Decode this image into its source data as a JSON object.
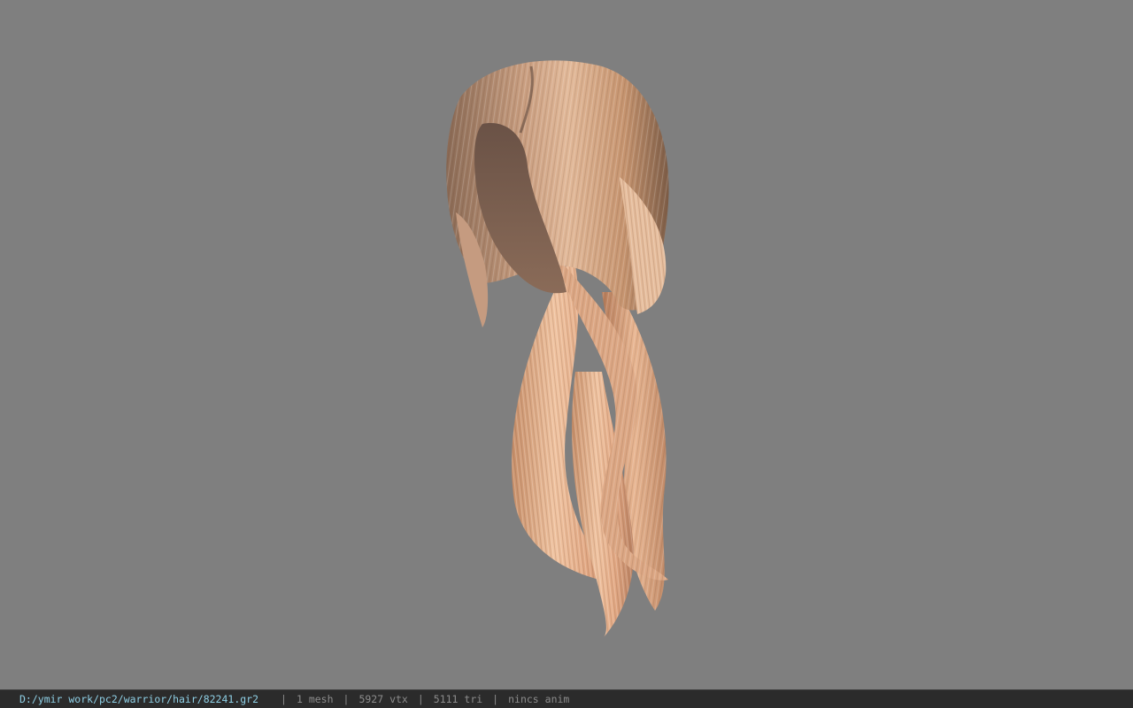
{
  "viewport": {
    "background": "#7f7f7f",
    "model_name": "hair-model"
  },
  "status_bar": {
    "file_path": "D:/ymir work/pc2/warrior/hair/82241.gr2",
    "separator": "|",
    "mesh_count": "1 mesh",
    "vertex_count": "5927 vtx",
    "triangle_count": "5111 tri",
    "anim_status": "nincs anim",
    "path_color": "#8fd0e6",
    "text_color": "#8c8c8c"
  }
}
